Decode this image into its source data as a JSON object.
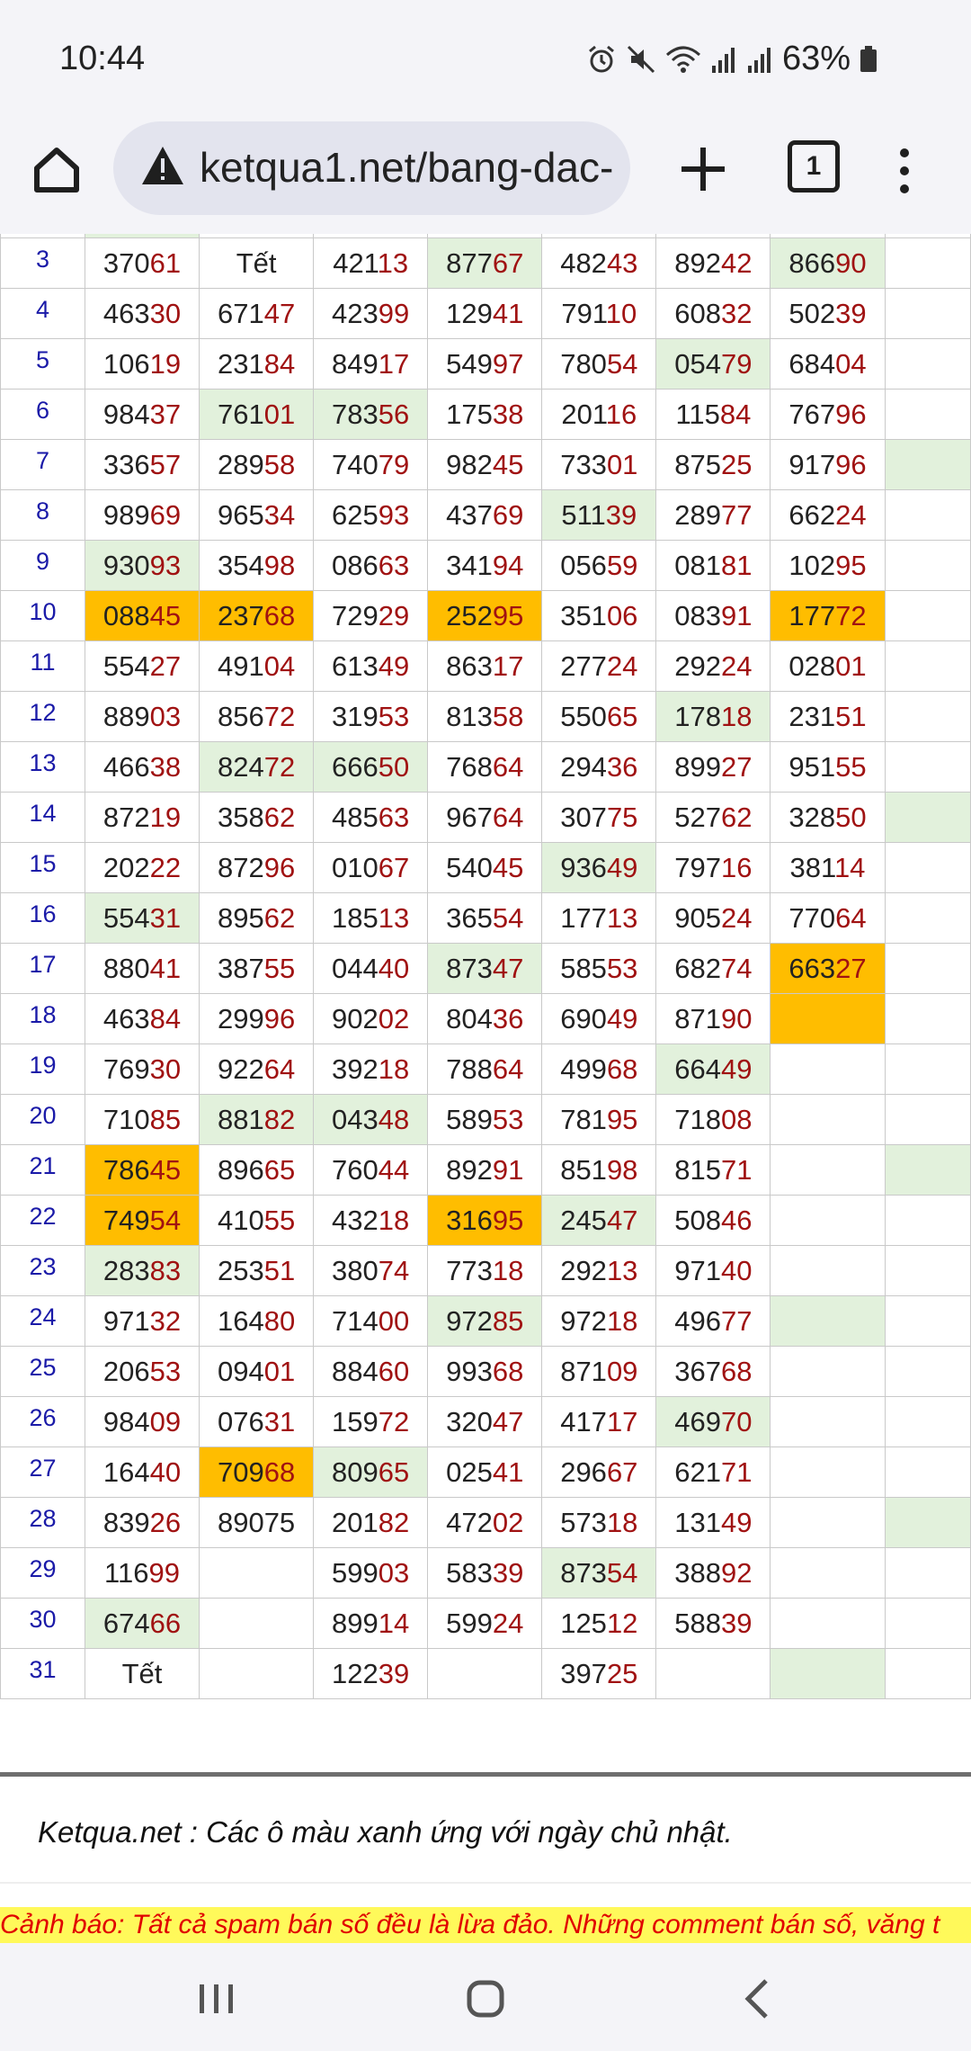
{
  "status_bar": {
    "time": "10:44",
    "battery": "63%"
  },
  "browser": {
    "url": "ketqua1.net/bang-dac-",
    "tab_count": "1"
  },
  "table": {
    "rows": [
      {
        "day": "3",
        "cells": [
          {
            "h": "370",
            "t": "61"
          },
          {
            "h": "Tết",
            "t": ""
          },
          {
            "h": "421",
            "t": "13"
          },
          {
            "h": "877",
            "t": "67",
            "bg": "g"
          },
          {
            "h": "482",
            "t": "43"
          },
          {
            "h": "892",
            "t": "42"
          },
          {
            "h": "866",
            "t": "90",
            "bg": "g"
          },
          {
            "h": "",
            "t": ""
          }
        ]
      },
      {
        "day": "4",
        "cells": [
          {
            "h": "463",
            "t": "30"
          },
          {
            "h": "671",
            "t": "47"
          },
          {
            "h": "423",
            "t": "99"
          },
          {
            "h": "129",
            "t": "41"
          },
          {
            "h": "791",
            "t": "10"
          },
          {
            "h": "608",
            "t": "32"
          },
          {
            "h": "502",
            "t": "39"
          },
          {
            "h": "",
            "t": ""
          }
        ]
      },
      {
        "day": "5",
        "cells": [
          {
            "h": "106",
            "t": "19"
          },
          {
            "h": "231",
            "t": "84"
          },
          {
            "h": "849",
            "t": "17"
          },
          {
            "h": "549",
            "t": "97"
          },
          {
            "h": "780",
            "t": "54"
          },
          {
            "h": "054",
            "t": "79",
            "bg": "g"
          },
          {
            "h": "684",
            "t": "04"
          },
          {
            "h": "",
            "t": ""
          }
        ]
      },
      {
        "day": "6",
        "cells": [
          {
            "h": "984",
            "t": "37"
          },
          {
            "h": "761",
            "t": "01",
            "bg": "g"
          },
          {
            "h": "783",
            "t": "56",
            "bg": "g"
          },
          {
            "h": "175",
            "t": "38"
          },
          {
            "h": "201",
            "t": "16"
          },
          {
            "h": "115",
            "t": "84"
          },
          {
            "h": "767",
            "t": "96"
          },
          {
            "h": "",
            "t": ""
          }
        ]
      },
      {
        "day": "7",
        "cells": [
          {
            "h": "336",
            "t": "57"
          },
          {
            "h": "289",
            "t": "58"
          },
          {
            "h": "740",
            "t": "79"
          },
          {
            "h": "982",
            "t": "45"
          },
          {
            "h": "733",
            "t": "01"
          },
          {
            "h": "875",
            "t": "25"
          },
          {
            "h": "917",
            "t": "96"
          },
          {
            "h": "",
            "t": "",
            "bg": "g"
          }
        ]
      },
      {
        "day": "8",
        "cells": [
          {
            "h": "989",
            "t": "69"
          },
          {
            "h": "965",
            "t": "34"
          },
          {
            "h": "625",
            "t": "93"
          },
          {
            "h": "437",
            "t": "69"
          },
          {
            "h": "511",
            "t": "39",
            "bg": "g"
          },
          {
            "h": "289",
            "t": "77"
          },
          {
            "h": "662",
            "t": "24"
          },
          {
            "h": "",
            "t": ""
          }
        ]
      },
      {
        "day": "9",
        "cells": [
          {
            "h": "930",
            "t": "93",
            "bg": "g"
          },
          {
            "h": "354",
            "t": "98"
          },
          {
            "h": "086",
            "t": "63"
          },
          {
            "h": "341",
            "t": "94"
          },
          {
            "h": "056",
            "t": "59"
          },
          {
            "h": "081",
            "t": "81"
          },
          {
            "h": "102",
            "t": "95"
          },
          {
            "h": "",
            "t": ""
          }
        ]
      },
      {
        "day": "10",
        "cells": [
          {
            "h": "088",
            "t": "45",
            "bg": "o"
          },
          {
            "h": "237",
            "t": "68",
            "bg": "o"
          },
          {
            "h": "729",
            "t": "29"
          },
          {
            "h": "252",
            "t": "95",
            "bg": "o"
          },
          {
            "h": "351",
            "t": "06"
          },
          {
            "h": "083",
            "t": "91"
          },
          {
            "h": "177",
            "t": "72",
            "bg": "o"
          },
          {
            "h": "",
            "t": ""
          }
        ]
      },
      {
        "day": "11",
        "cells": [
          {
            "h": "554",
            "t": "27"
          },
          {
            "h": "491",
            "t": "04"
          },
          {
            "h": "613",
            "t": "49"
          },
          {
            "h": "863",
            "t": "17"
          },
          {
            "h": "277",
            "t": "24"
          },
          {
            "h": "292",
            "t": "24"
          },
          {
            "h": "028",
            "t": "01"
          },
          {
            "h": "",
            "t": ""
          }
        ]
      },
      {
        "day": "12",
        "cells": [
          {
            "h": "889",
            "t": "03"
          },
          {
            "h": "856",
            "t": "72"
          },
          {
            "h": "319",
            "t": "53"
          },
          {
            "h": "813",
            "t": "58"
          },
          {
            "h": "550",
            "t": "65"
          },
          {
            "h": "178",
            "t": "18",
            "bg": "g"
          },
          {
            "h": "231",
            "t": "51"
          },
          {
            "h": "",
            "t": ""
          }
        ]
      },
      {
        "day": "13",
        "cells": [
          {
            "h": "466",
            "t": "38"
          },
          {
            "h": "824",
            "t": "72",
            "bg": "g"
          },
          {
            "h": "666",
            "t": "50",
            "bg": "g"
          },
          {
            "h": "768",
            "t": "64"
          },
          {
            "h": "294",
            "t": "36"
          },
          {
            "h": "899",
            "t": "27"
          },
          {
            "h": "951",
            "t": "55"
          },
          {
            "h": "",
            "t": ""
          }
        ]
      },
      {
        "day": "14",
        "cells": [
          {
            "h": "872",
            "t": "19"
          },
          {
            "h": "358",
            "t": "62"
          },
          {
            "h": "485",
            "t": "63"
          },
          {
            "h": "967",
            "t": "64"
          },
          {
            "h": "307",
            "t": "75"
          },
          {
            "h": "527",
            "t": "62"
          },
          {
            "h": "328",
            "t": "50"
          },
          {
            "h": "",
            "t": "",
            "bg": "g"
          }
        ]
      },
      {
        "day": "15",
        "cells": [
          {
            "h": "202",
            "t": "22"
          },
          {
            "h": "872",
            "t": "96"
          },
          {
            "h": "010",
            "t": "67"
          },
          {
            "h": "540",
            "t": "45"
          },
          {
            "h": "936",
            "t": "49",
            "bg": "g"
          },
          {
            "h": "797",
            "t": "16"
          },
          {
            "h": "381",
            "t": "14"
          },
          {
            "h": "",
            "t": ""
          }
        ]
      },
      {
        "day": "16",
        "cells": [
          {
            "h": "554",
            "t": "31",
            "bg": "g"
          },
          {
            "h": "895",
            "t": "62"
          },
          {
            "h": "185",
            "t": "13"
          },
          {
            "h": "365",
            "t": "54"
          },
          {
            "h": "177",
            "t": "13"
          },
          {
            "h": "905",
            "t": "24"
          },
          {
            "h": "770",
            "t": "64"
          },
          {
            "h": "",
            "t": ""
          }
        ]
      },
      {
        "day": "17",
        "cells": [
          {
            "h": "880",
            "t": "41"
          },
          {
            "h": "387",
            "t": "55"
          },
          {
            "h": "044",
            "t": "40"
          },
          {
            "h": "873",
            "t": "47",
            "bg": "g"
          },
          {
            "h": "585",
            "t": "53"
          },
          {
            "h": "682",
            "t": "74"
          },
          {
            "h": "663",
            "t": "27",
            "bg": "o"
          },
          {
            "h": "",
            "t": ""
          }
        ]
      },
      {
        "day": "18",
        "cells": [
          {
            "h": "463",
            "t": "84"
          },
          {
            "h": "299",
            "t": "96"
          },
          {
            "h": "902",
            "t": "02"
          },
          {
            "h": "804",
            "t": "36"
          },
          {
            "h": "690",
            "t": "49"
          },
          {
            "h": "871",
            "t": "90"
          },
          {
            "h": "",
            "t": "",
            "bg": "o"
          },
          {
            "h": "",
            "t": ""
          }
        ]
      },
      {
        "day": "19",
        "cells": [
          {
            "h": "769",
            "t": "30"
          },
          {
            "h": "922",
            "t": "64"
          },
          {
            "h": "392",
            "t": "18"
          },
          {
            "h": "788",
            "t": "64"
          },
          {
            "h": "499",
            "t": "68"
          },
          {
            "h": "664",
            "t": "49",
            "bg": "g"
          },
          {
            "h": "",
            "t": ""
          },
          {
            "h": "",
            "t": ""
          }
        ]
      },
      {
        "day": "20",
        "cells": [
          {
            "h": "710",
            "t": "85"
          },
          {
            "h": "881",
            "t": "82",
            "bg": "g"
          },
          {
            "h": "043",
            "t": "48",
            "bg": "g"
          },
          {
            "h": "589",
            "t": "53"
          },
          {
            "h": "781",
            "t": "95"
          },
          {
            "h": "718",
            "t": "08"
          },
          {
            "h": "",
            "t": ""
          },
          {
            "h": "",
            "t": ""
          }
        ]
      },
      {
        "day": "21",
        "cells": [
          {
            "h": "786",
            "t": "45",
            "bg": "o"
          },
          {
            "h": "896",
            "t": "65"
          },
          {
            "h": "760",
            "t": "44"
          },
          {
            "h": "892",
            "t": "91"
          },
          {
            "h": "851",
            "t": "98"
          },
          {
            "h": "815",
            "t": "71"
          },
          {
            "h": "",
            "t": ""
          },
          {
            "h": "",
            "t": "",
            "bg": "g"
          }
        ]
      },
      {
        "day": "22",
        "cells": [
          {
            "h": "749",
            "t": "54",
            "bg": "o"
          },
          {
            "h": "410",
            "t": "55"
          },
          {
            "h": "432",
            "t": "18"
          },
          {
            "h": "316",
            "t": "95",
            "bg": "o"
          },
          {
            "h": "245",
            "t": "47",
            "bg": "g"
          },
          {
            "h": "508",
            "t": "46"
          },
          {
            "h": "",
            "t": ""
          },
          {
            "h": "",
            "t": ""
          }
        ]
      },
      {
        "day": "23",
        "cells": [
          {
            "h": "283",
            "t": "83",
            "bg": "g"
          },
          {
            "h": "253",
            "t": "51"
          },
          {
            "h": "380",
            "t": "74"
          },
          {
            "h": "773",
            "t": "18"
          },
          {
            "h": "292",
            "t": "13"
          },
          {
            "h": "971",
            "t": "40"
          },
          {
            "h": "",
            "t": ""
          },
          {
            "h": "",
            "t": ""
          }
        ]
      },
      {
        "day": "24",
        "cells": [
          {
            "h": "971",
            "t": "32"
          },
          {
            "h": "164",
            "t": "80"
          },
          {
            "h": "714",
            "t": "00"
          },
          {
            "h": "972",
            "t": "85",
            "bg": "g"
          },
          {
            "h": "972",
            "t": "18"
          },
          {
            "h": "496",
            "t": "77"
          },
          {
            "h": "",
            "t": "",
            "bg": "g"
          },
          {
            "h": "",
            "t": ""
          }
        ]
      },
      {
        "day": "25",
        "cells": [
          {
            "h": "206",
            "t": "53"
          },
          {
            "h": "094",
            "t": "01"
          },
          {
            "h": "884",
            "t": "60"
          },
          {
            "h": "993",
            "t": "68"
          },
          {
            "h": "871",
            "t": "09"
          },
          {
            "h": "367",
            "t": "68"
          },
          {
            "h": "",
            "t": ""
          },
          {
            "h": "",
            "t": ""
          }
        ]
      },
      {
        "day": "26",
        "cells": [
          {
            "h": "984",
            "t": "09"
          },
          {
            "h": "076",
            "t": "31"
          },
          {
            "h": "159",
            "t": "72"
          },
          {
            "h": "320",
            "t": "47"
          },
          {
            "h": "417",
            "t": "17"
          },
          {
            "h": "469",
            "t": "70",
            "bg": "g"
          },
          {
            "h": "",
            "t": ""
          },
          {
            "h": "",
            "t": ""
          }
        ]
      },
      {
        "day": "27",
        "cells": [
          {
            "h": "164",
            "t": "40"
          },
          {
            "h": "709",
            "t": "68",
            "bg": "o"
          },
          {
            "h": "809",
            "t": "65",
            "bg": "g"
          },
          {
            "h": "025",
            "t": "41"
          },
          {
            "h": "296",
            "t": "67"
          },
          {
            "h": "621",
            "t": "71"
          },
          {
            "h": "",
            "t": ""
          },
          {
            "h": "",
            "t": ""
          }
        ]
      },
      {
        "day": "28",
        "cells": [
          {
            "h": "839",
            "t": "26"
          },
          {
            "h": "89075",
            "t": ""
          },
          {
            "h": "201",
            "t": "82"
          },
          {
            "h": "472",
            "t": "02"
          },
          {
            "h": "573",
            "t": "18"
          },
          {
            "h": "131",
            "t": "49"
          },
          {
            "h": "",
            "t": ""
          },
          {
            "h": "",
            "t": "",
            "bg": "g"
          }
        ]
      },
      {
        "day": "29",
        "cells": [
          {
            "h": "116",
            "t": "99"
          },
          {
            "h": "",
            "t": ""
          },
          {
            "h": "599",
            "t": "03"
          },
          {
            "h": "583",
            "t": "39"
          },
          {
            "h": "873",
            "t": "54",
            "bg": "g"
          },
          {
            "h": "388",
            "t": "92"
          },
          {
            "h": "",
            "t": ""
          },
          {
            "h": "",
            "t": ""
          }
        ]
      },
      {
        "day": "30",
        "cells": [
          {
            "h": "674",
            "t": "66",
            "bg": "g"
          },
          {
            "h": "",
            "t": ""
          },
          {
            "h": "899",
            "t": "14"
          },
          {
            "h": "599",
            "t": "24"
          },
          {
            "h": "125",
            "t": "12"
          },
          {
            "h": "588",
            "t": "39"
          },
          {
            "h": "",
            "t": ""
          },
          {
            "h": "",
            "t": ""
          }
        ]
      },
      {
        "day": "31",
        "cells": [
          {
            "h": "Tết",
            "t": ""
          },
          {
            "h": "",
            "t": ""
          },
          {
            "h": "122",
            "t": "39"
          },
          {
            "h": "",
            "t": ""
          },
          {
            "h": "397",
            "t": "25"
          },
          {
            "h": "",
            "t": ""
          },
          {
            "h": "",
            "t": "",
            "bg": "g"
          },
          {
            "h": "",
            "t": ""
          }
        ]
      }
    ]
  },
  "note": "Ketqua.net : Các ô màu xanh ứng với ngày chủ nhật.",
  "warning": {
    "label": "Cảnh báo:",
    "text": " Tất cả spam bán số đều là lừa đảo. Những comment bán số, văng t"
  },
  "colors": {
    "green_cell": "#e2f1dc",
    "orange_cell": "#ffbd00",
    "digit_tail": "#a01212",
    "day_number": "#1a1aa8"
  }
}
